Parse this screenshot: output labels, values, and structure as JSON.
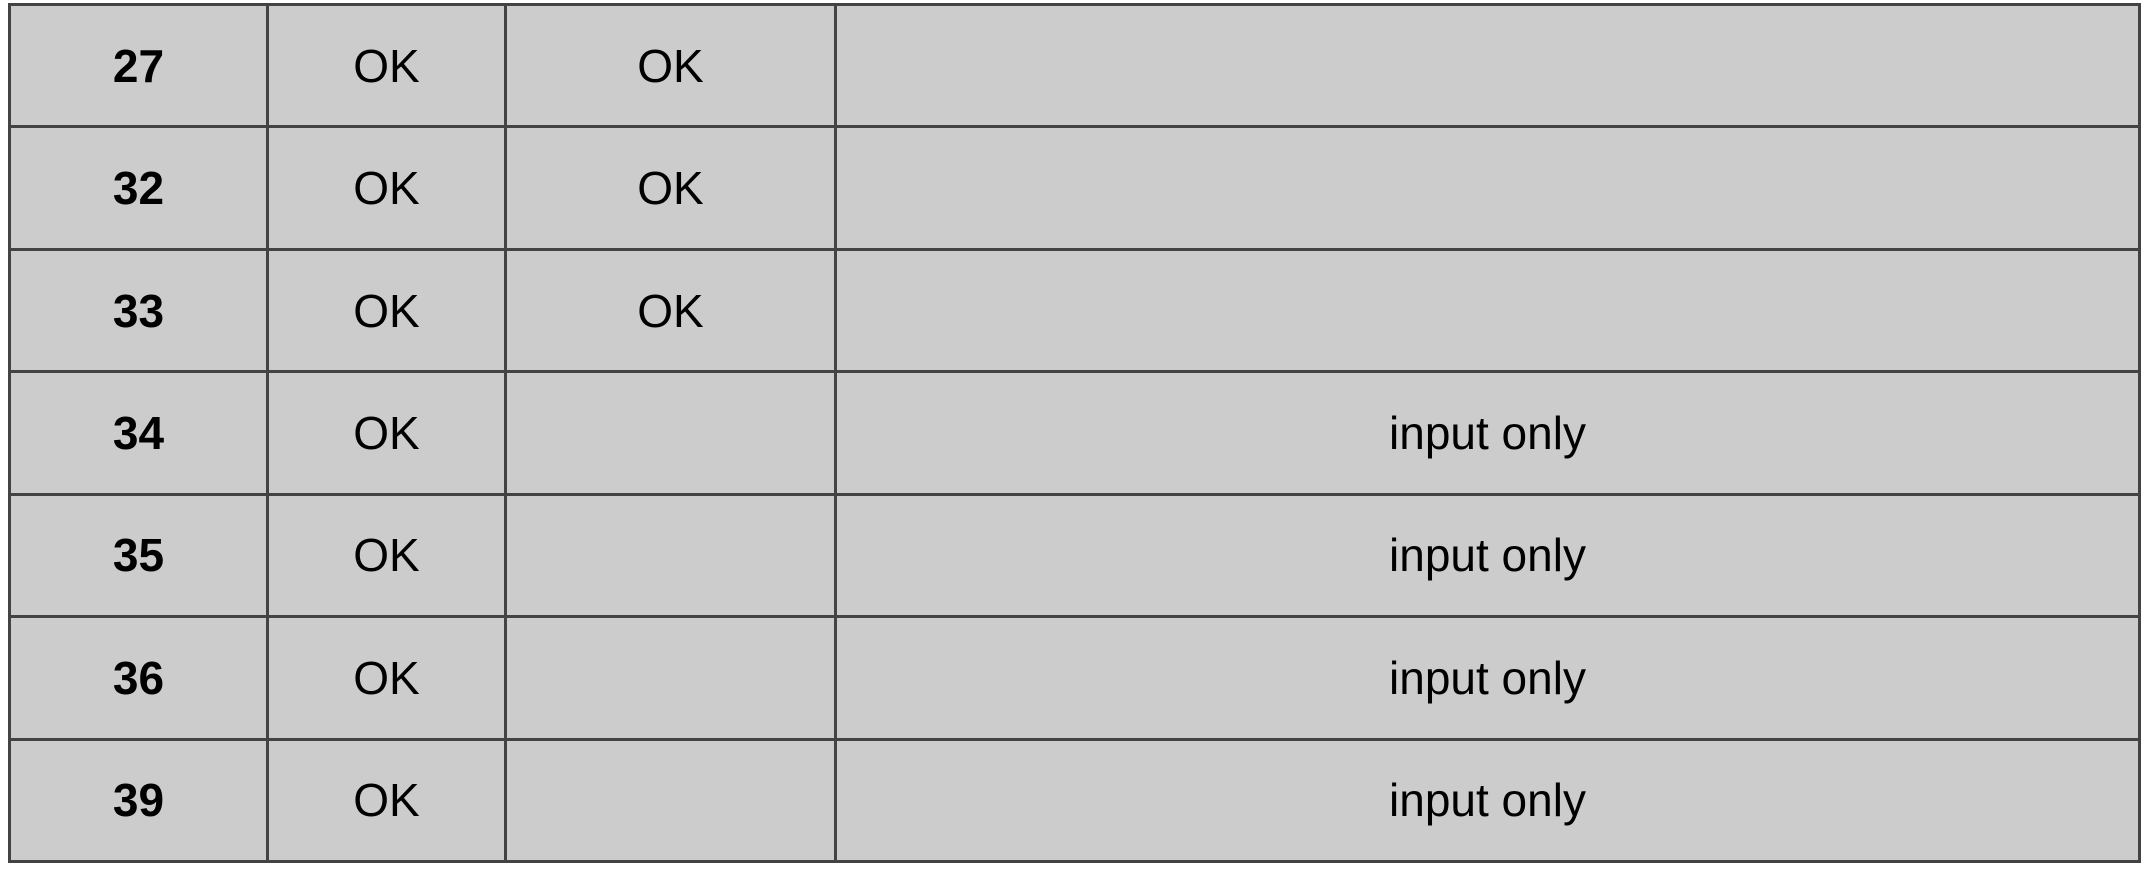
{
  "table": {
    "rows": [
      {
        "gpio": "27",
        "input": "OK",
        "output": "OK",
        "notes": ""
      },
      {
        "gpio": "32",
        "input": "OK",
        "output": "OK",
        "notes": ""
      },
      {
        "gpio": "33",
        "input": "OK",
        "output": "OK",
        "notes": ""
      },
      {
        "gpio": "34",
        "input": "OK",
        "output": "",
        "notes": "input only"
      },
      {
        "gpio": "35",
        "input": "OK",
        "output": "",
        "notes": "input only"
      },
      {
        "gpio": "36",
        "input": "OK",
        "output": "",
        "notes": "input only"
      },
      {
        "gpio": "39",
        "input": "OK",
        "output": "",
        "notes": "input only"
      }
    ]
  },
  "colors": {
    "cell_background": "#cccccc",
    "border": "#434343",
    "text": "#000000"
  }
}
